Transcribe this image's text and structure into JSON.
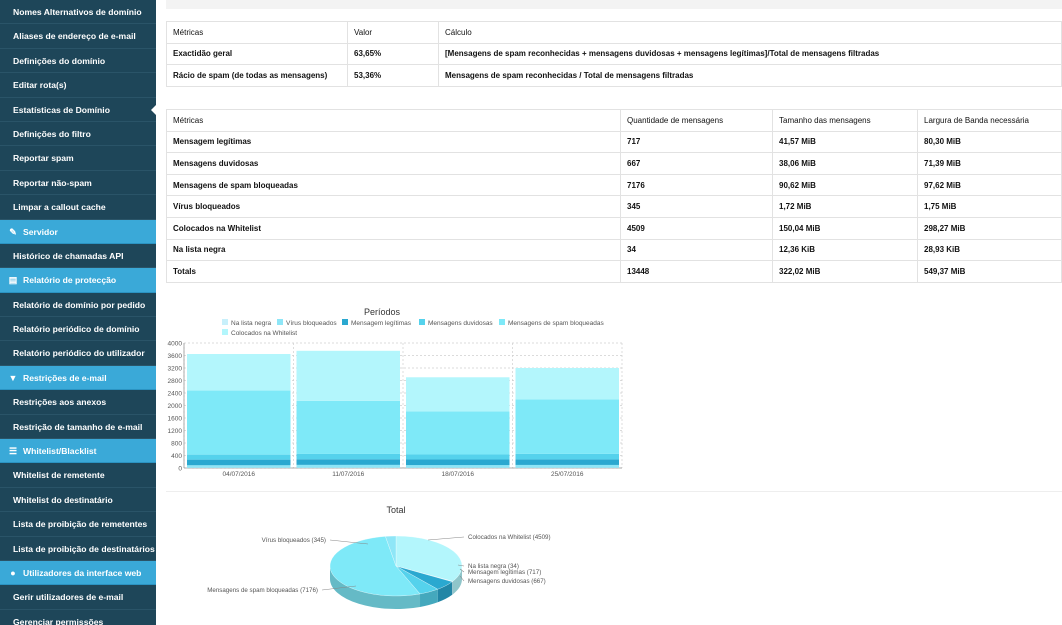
{
  "sidebar": {
    "items": [
      {
        "type": "item",
        "label": "Nomes Alternativos de domínio"
      },
      {
        "type": "item",
        "label": "Aliases de endereço de e-mail"
      },
      {
        "type": "item",
        "label": "Definições do domínio"
      },
      {
        "type": "item",
        "label": "Editar rota(s)"
      },
      {
        "type": "item",
        "label": "Estatísticas de Domínio",
        "active": true
      },
      {
        "type": "item",
        "label": "Definições do filtro"
      },
      {
        "type": "item",
        "label": "Reportar spam"
      },
      {
        "type": "item",
        "label": "Reportar não-spam"
      },
      {
        "type": "item",
        "label": "Limpar a callout cache"
      },
      {
        "type": "head",
        "label": "Servidor",
        "icon": "wrench-icon",
        "glyph": "✎"
      },
      {
        "type": "item",
        "label": "Histórico de chamadas API"
      },
      {
        "type": "head",
        "label": "Relatório de protecção",
        "icon": "document-icon",
        "glyph": "▤"
      },
      {
        "type": "item",
        "label": "Relatório de domínio por pedido"
      },
      {
        "type": "item",
        "label": "Relatório periódico de domínio"
      },
      {
        "type": "item",
        "label": "Relatório periódico do utilizador"
      },
      {
        "type": "head",
        "label": "Restrições de e-mail",
        "icon": "filter-icon",
        "glyph": "▼"
      },
      {
        "type": "item",
        "label": "Restrições aos anexos"
      },
      {
        "type": "item",
        "label": "Restrição de tamanho de e-mail"
      },
      {
        "type": "head",
        "label": "Whitelist/Blacklist",
        "icon": "list-icon",
        "glyph": "☰"
      },
      {
        "type": "item",
        "label": "Whitelist de remetente"
      },
      {
        "type": "item",
        "label": "Whitelist do destinatário"
      },
      {
        "type": "item",
        "label": "Lista de proibição de remetentes"
      },
      {
        "type": "item",
        "label": "Lista de proibição de destinatários"
      },
      {
        "type": "head",
        "label": "Utilizadores da interface web",
        "icon": "user-icon",
        "glyph": "●"
      },
      {
        "type": "item",
        "label": "Gerir utilizadores de e-mail"
      },
      {
        "type": "item",
        "label": "Gerenciar permissões"
      }
    ]
  },
  "metrics_table": {
    "headers": [
      "Métricas",
      "Valor",
      "Cálculo"
    ],
    "rows": [
      [
        "Exactidão geral",
        "63,65%",
        "[Mensagens de spam reconhecidas + mensagens duvidosas + mensagens legítimas]/Total de mensagens filtradas"
      ],
      [
        "Rácio de spam (de todas as mensagens)",
        "53,36%",
        "Mensagens de spam reconhecidas / Total de mensagens filtradas"
      ]
    ]
  },
  "messages_table": {
    "headers": [
      "Métricas",
      "Quantidade de mensagens",
      "Tamanho das mensagens",
      "Largura de Banda necessária"
    ],
    "rows": [
      [
        "Mensagem legítimas",
        "717",
        "41,57 MiB",
        "80,30 MiB"
      ],
      [
        "Mensagens duvidosas",
        "667",
        "38,06 MiB",
        "71,39 MiB"
      ],
      [
        "Mensagens de spam bloqueadas",
        "7176",
        "90,62 MiB",
        "97,62 MiB"
      ],
      [
        "Vírus bloqueados",
        "345",
        "1,72 MiB",
        "1,75 MiB"
      ],
      [
        "Colocados na Whitelist",
        "4509",
        "150,04 MiB",
        "298,27 MiB"
      ],
      [
        "Na lista negra",
        "34",
        "12,36 KiB",
        "28,93 KiB"
      ],
      [
        "Totals",
        "13448",
        "322,02 MiB",
        "549,37 MiB"
      ]
    ]
  },
  "chart_data": [
    {
      "type": "bar",
      "stacked": true,
      "title": "Períodos",
      "categories": [
        "04/07/2016",
        "11/07/2016",
        "18/07/2016",
        "25/07/2016"
      ],
      "ylim": [
        0,
        4000
      ],
      "yticks": [
        0,
        400,
        800,
        1200,
        1600,
        2000,
        2400,
        2800,
        3200,
        3600,
        4000
      ],
      "grid": true,
      "legend": "top",
      "series": [
        {
          "name": "Na lista negra",
          "color": "#c8f0fb",
          "values": [
            8,
            10,
            8,
            8
          ]
        },
        {
          "name": "Vírus bloqueados",
          "color": "#8ee6f7",
          "values": [
            80,
            90,
            85,
            90
          ]
        },
        {
          "name": "Mensagem legítimas",
          "color": "#2aa8d0",
          "values": [
            180,
            180,
            180,
            177
          ]
        },
        {
          "name": "Mensagens duvidosas",
          "color": "#55d2ec",
          "values": [
            160,
            170,
            160,
            177
          ]
        },
        {
          "name": "Mensagens de spam bloqueadas",
          "color": "#7ee9f8",
          "values": [
            2050,
            1700,
            1380,
            1746
          ]
        },
        {
          "name": "Colocados na Whitelist",
          "color": "#b3f6fc",
          "values": [
            1170,
            1600,
            1090,
            1002
          ]
        }
      ]
    },
    {
      "type": "pie",
      "title": "Total",
      "slices": [
        {
          "label": "Colocados na Whitelist (4509)",
          "value": 4509,
          "color": "#b3f6fc"
        },
        {
          "label": "Na lista negra (34)",
          "value": 34,
          "color": "#c8f0fb"
        },
        {
          "label": "Mensagem legítimas (717)",
          "value": 717,
          "color": "#2aa8d0"
        },
        {
          "label": "Mensagens duvidosas (667)",
          "value": 667,
          "color": "#55d2ec"
        },
        {
          "label": "Mensagens de spam bloqueadas (7176)",
          "value": 7176,
          "color": "#7ee9f8"
        },
        {
          "label": "Vírus bloqueados (345)",
          "value": 345,
          "color": "#8ee6f7"
        }
      ]
    }
  ]
}
